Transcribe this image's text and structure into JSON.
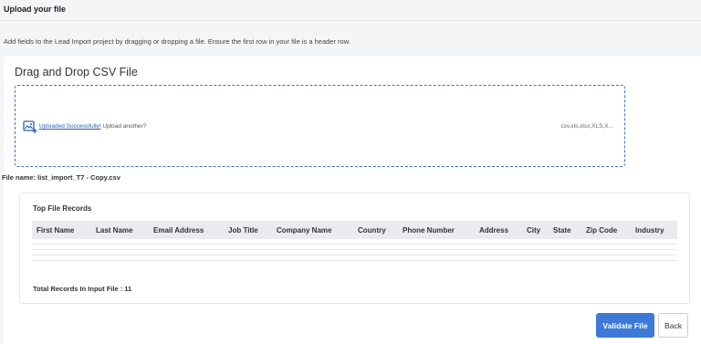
{
  "header": {
    "title": "Upload your file",
    "instructions": "Add fields to the Lead Import project by dragging or dropping a file. Ensure the first row in your file is a header row."
  },
  "dropzone": {
    "title": "Drag and Drop CSV File",
    "success_text": "Uploaded Successfully!",
    "upload_another_text": " Upload another?",
    "formats": "csv,xls,xlsx,XLS,X..."
  },
  "file": {
    "name_label": "File name: list_import_T7 - Copy.csv"
  },
  "records": {
    "title": "Top File Records",
    "columns": [
      "First Name",
      "Last Name",
      "Email Address",
      "Job Title",
      "Company Name",
      "Country",
      "Phone Number",
      "Address",
      "City",
      "State",
      "Zip Code",
      "Industry"
    ],
    "total_text": "Total Records In Input File : 11"
  },
  "actions": {
    "validate_label": "Validate File",
    "back_label": "Back"
  },
  "colors": {
    "accent": "#3d7ad8",
    "dropzone_border": "#3a72c8",
    "background": "#f4f5f7"
  }
}
